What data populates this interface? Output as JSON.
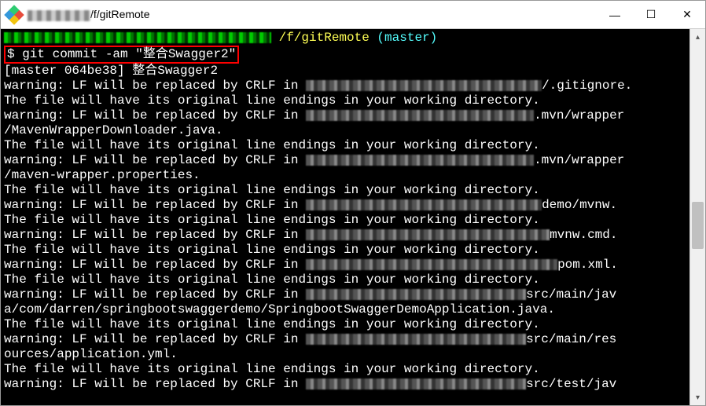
{
  "title": {
    "path_suffix": "/f/gitRemote"
  },
  "prompt": {
    "path": " /f/gitRemote",
    "branch": " (master)"
  },
  "command": {
    "dollar": "$ ",
    "text": "git commit -am \"整合Swagger2\""
  },
  "commit_result": "[master 064be38] 整合Swagger2",
  "lines": {
    "warn_prefix": "warning: LF will be replaced by CRLF in ",
    "file_line": "The file will have its original line endings in your working directory.",
    "suffix_gitignore": "/.gitignore.",
    "suffix_mvn_wrapper": ".mvn/wrapper",
    "path_maven_downloader": "/MavenWrapperDownloader.java.",
    "path_maven_props": "/maven-wrapper.properties.",
    "suffix_demo_mvnw": "demo/mvnw.",
    "suffix_mvnw_cmd": "mvnw.cmd.",
    "suffix_pom": "pom.xml.",
    "suffix_src_main_jav": "src/main/jav",
    "path_app": "a/com/darren/springbootswaggerdemo/SpringbootSwaggerDemoApplication.java.",
    "suffix_src_main_res": "src/main/res",
    "path_app_yml": "ources/application.yml.",
    "suffix_src_test_jav": "src/test/jav"
  }
}
